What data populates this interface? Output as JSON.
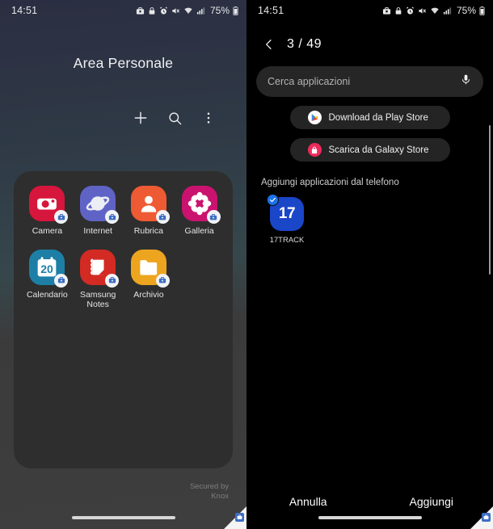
{
  "status_bar": {
    "time": "14:51",
    "battery_pct": "75%",
    "icons": [
      "work-profile-icon",
      "lock-icon",
      "alarm-icon",
      "mute-icon",
      "wifi-icon",
      "signal-icon",
      "battery-icon"
    ]
  },
  "left_panel": {
    "title": "Area Personale",
    "actions": [
      {
        "name": "add-button",
        "label": "+"
      },
      {
        "name": "search-button",
        "label": "search-icon"
      },
      {
        "name": "more-options-button",
        "label": "more-vertical-icon"
      }
    ],
    "apps": [
      {
        "label": "Camera",
        "color": "#d6163c",
        "icon": "camera-icon",
        "badge": "work-profile-badge"
      },
      {
        "label": "Internet",
        "color": "#6063c6",
        "icon": "internet-icon",
        "badge": "work-profile-badge"
      },
      {
        "label": "Rubrica",
        "color": "#ee5a33",
        "icon": "contacts-icon",
        "badge": "work-profile-badge"
      },
      {
        "label": "Galleria",
        "color": "#c9136f",
        "icon": "gallery-icon",
        "badge": "work-profile-badge"
      },
      {
        "label": "Calendario",
        "color": "#1d7fa6",
        "icon": "calendar-icon",
        "badge": "work-profile-badge",
        "day": "20"
      },
      {
        "label": "Samsung\nNotes",
        "color": "#d32a24",
        "icon": "notes-icon",
        "badge": "work-profile-badge"
      },
      {
        "label": "Archivio",
        "color": "#eda51f",
        "icon": "files-folder-icon",
        "badge": "work-profile-badge"
      }
    ],
    "secured_by": "Secured by",
    "secured_brand": "Knox"
  },
  "right_panel": {
    "counter": "3 / 49",
    "back": "back-chevron-icon",
    "search": {
      "placeholder": "Cerca applicazioni",
      "mic": "microphone-icon"
    },
    "store_buttons": [
      {
        "label": "Download da Play Store",
        "icon": "play-store-icon",
        "color": "#ffffff"
      },
      {
        "label": "Scarica da Galaxy Store",
        "icon": "galaxy-store-icon",
        "color": "#ed2a5b"
      }
    ],
    "section_title": "Aggiungi applicazioni dal telefono",
    "phone_apps": [
      {
        "label": "17TRACK",
        "icon_text": "17",
        "color": "#1a46c8",
        "selected": true
      }
    ],
    "footer": {
      "cancel": "Annulla",
      "confirm": "Aggiungi"
    }
  }
}
